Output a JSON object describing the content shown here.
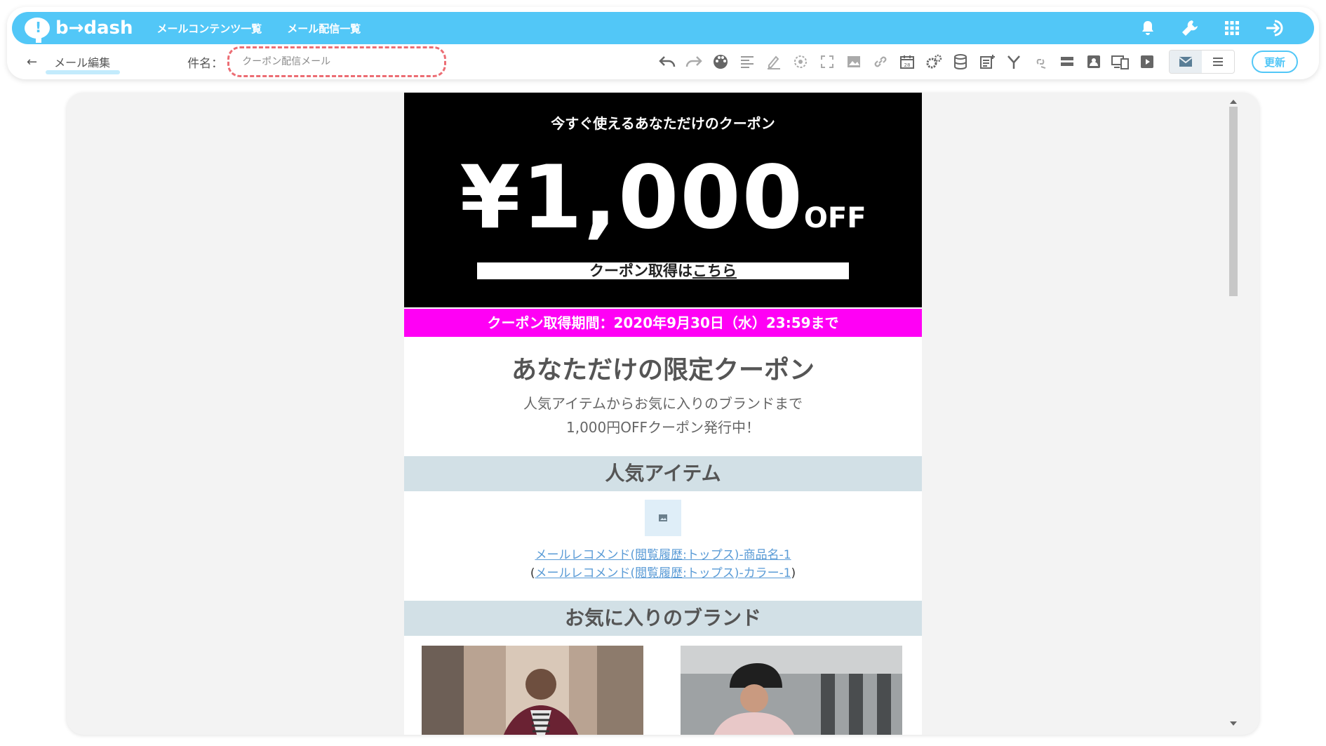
{
  "header": {
    "logo": "b→dash",
    "logo_mark": "!",
    "nav": [
      "メールコンテンツ一覧",
      "メール配信一覧"
    ]
  },
  "toolbar": {
    "back_icon": "arrow-left-icon",
    "breadcrumb": "メール編集",
    "subject_label": "件名：",
    "subject_placeholder": "クーポン配信メール",
    "update_label": "更新"
  },
  "email": {
    "hero_subtitle": "今すぐ使えるあなただけのクーポン",
    "hero_price": "¥1,000",
    "hero_off": "OFF",
    "hero_button_text": "クーポン取得は",
    "hero_button_link": "こちら",
    "period": "クーポン取得期間：2020年9月30日（水）23:59まで",
    "limited_title": "あなただけの限定クーポン",
    "desc_line1": "人気アイテムからお気に入りのブランドまで",
    "desc_line2": "1,000円OFFクーポン発行中！",
    "popular_title": "人気アイテム",
    "item_name_link": "メールレコメンド(閲覧履歴:トップス)-商品名-1",
    "item_color_open": "(",
    "item_color_link": "メールレコメンド(閲覧履歴:トップス)-カラー-1",
    "item_color_close": ")",
    "brand_title": "お気に入りのブランド"
  },
  "colors": {
    "accent": "#52c7f7",
    "period_bg": "#ff00f5",
    "band_bg": "#d2e0e6",
    "highlight_dash": "#ec6d74"
  }
}
